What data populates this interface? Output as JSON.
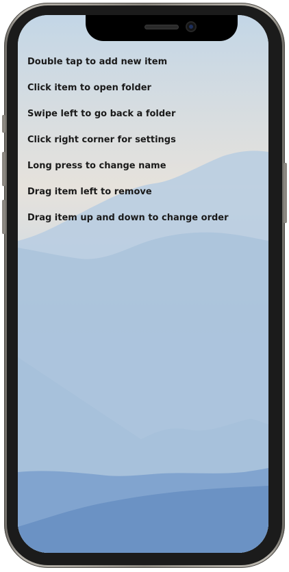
{
  "instructions": [
    "Double tap to add new item",
    "Click item to open folder",
    "Swipe left to go back a folder",
    "Click right corner for settings",
    "Long press to change name",
    "Drag item left to remove",
    "Drag item up and down to change order"
  ],
  "colors": {
    "text": "#1a1a1a",
    "sky_top": "#c3d6e6",
    "sky_horizon": "#e6e2dc",
    "mountain_far": "#b7cde2",
    "mountain_mid": "#a6c0da",
    "mountain_near": "#7a9fcc",
    "mountain_front": "#6b92c4",
    "phone_frame": "#8c8880"
  },
  "icons": {
    "background": "misty-mountains-wallpaper",
    "front_camera": "camera-icon",
    "earpiece": "speaker-icon"
  }
}
